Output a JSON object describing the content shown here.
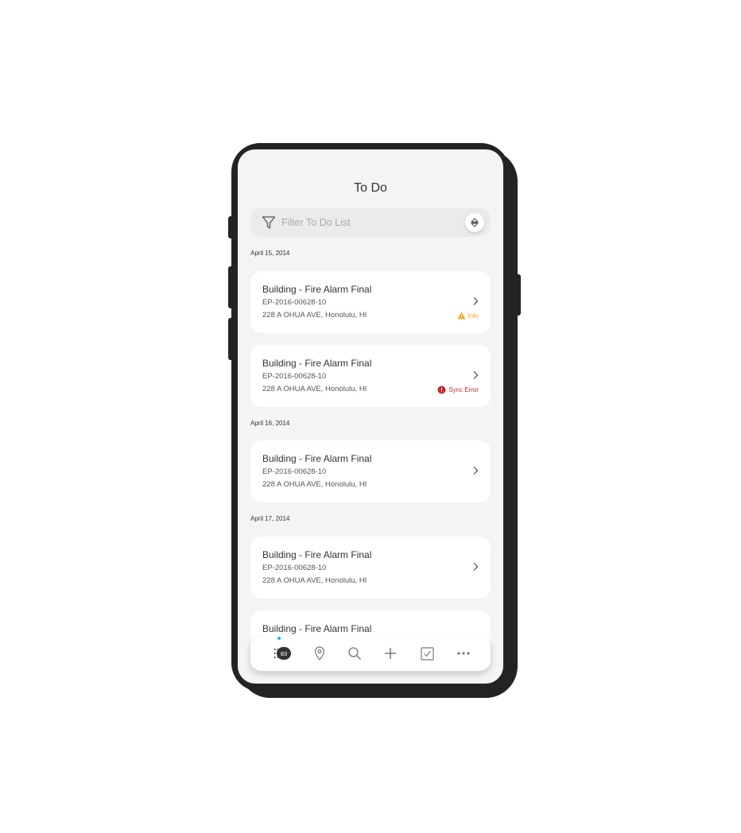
{
  "header": {
    "title": "To Do"
  },
  "filter": {
    "placeholder": "Filter To Do List"
  },
  "groups": [
    {
      "date": "April 15, 2014"
    },
    {
      "date": "April 16, 2014"
    },
    {
      "date": "April 17, 2014"
    }
  ],
  "cards": [
    {
      "title": "Building - Fire Alarm Final",
      "number": "EP-2016-00628-10",
      "address": "228 A OHUA AVE, Honolulu, HI",
      "status": "Info",
      "status_color": "#f5a623"
    },
    {
      "title": "Building - Fire Alarm Final",
      "number": "EP-2016-00628-10",
      "address": "228 A OHUA AVE, Honolulu, HI",
      "status": "Sync Error",
      "status_color": "#c62828"
    },
    {
      "title": "Building - Fire Alarm Final",
      "number": "EP-2016-00628-10",
      "address": "228 A OHUA AVE, Honolulu, HI"
    },
    {
      "title": "Building - Fire Alarm Final",
      "number": "EP-2016-00628-10",
      "address": "228 A OHUA AVE, Honolulu, HI"
    },
    {
      "title": "Building - Fire Alarm Final"
    }
  ],
  "nav": {
    "items": [
      "todo-list-icon",
      "map-pin-icon",
      "search-icon",
      "plus-icon",
      "checkbox-icon",
      "more-icon"
    ],
    "todo_badge": "83",
    "accent": "#1cb8d6"
  }
}
